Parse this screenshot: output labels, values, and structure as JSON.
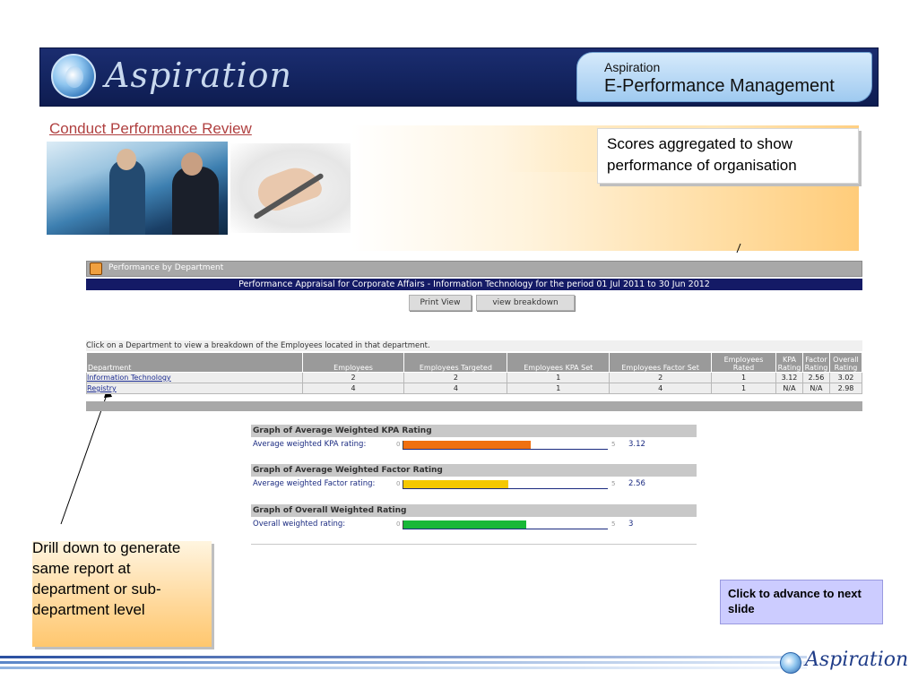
{
  "banner": {
    "brand": "Aspiration",
    "right_line1": "Aspiration",
    "right_line2": "E-Performance Management"
  },
  "slide": {
    "link_title": "Conduct Performance Review",
    "callout_top": "Scores aggregated to show performance of  organisation",
    "callout_left": "Drill down to generate same report at department or sub-department level",
    "advance": "Click to advance to next slide"
  },
  "app": {
    "window_title": "Performance by Department",
    "subtitle": "Performance Appraisal for Corporate Affairs - Information Technology for the period 01 Jul 2011 to 30 Jun 2012",
    "print_button": "Print View",
    "breakdown_button": "view breakdown",
    "instruction": "Click on a Department to view a breakdown of the Employees located in that department.",
    "table": {
      "headers": {
        "department": "Department",
        "employees": "Employees",
        "targeted": "Employees Targeted",
        "kpa_set": "Employees KPA Set",
        "factor_set": "Employees Factor Set",
        "rated": "Employees Rated",
        "kpa_rating": "KPA Rating",
        "factor_rating": "Factor Rating",
        "overall_rating": "Overall Rating"
      },
      "rows": [
        {
          "department": "Information Technology",
          "employees": "2",
          "targeted": "2",
          "kpa_set": "1",
          "factor_set": "2",
          "rated": "1",
          "kpa_rating": "3.12",
          "factor_rating": "2.56",
          "overall_rating": "3.02"
        },
        {
          "department": "Registry",
          "employees": "4",
          "targeted": "4",
          "kpa_set": "1",
          "factor_set": "4",
          "rated": "1",
          "kpa_rating": "N/A",
          "factor_rating": "N/A",
          "overall_rating": "2.98"
        }
      ]
    },
    "graphs": [
      {
        "title": "Graph of Average Weighted KPA Rating",
        "label": "Average weighted KPA rating:",
        "min": "0",
        "max": "5",
        "value": 3.12,
        "value_text": "3.12",
        "color": "#f07010"
      },
      {
        "title": "Graph of Average Weighted Factor Rating",
        "label": "Average weighted Factor rating:",
        "min": "0",
        "max": "5",
        "value": 2.56,
        "value_text": "2.56",
        "color": "#f5c800"
      },
      {
        "title": "Graph of Overall Weighted Rating",
        "label": "Overall weighted rating:",
        "min": "0",
        "max": "5",
        "value": 3,
        "value_text": "3",
        "color": "#18b838"
      }
    ]
  },
  "footer": {
    "brand": "Aspiration"
  }
}
